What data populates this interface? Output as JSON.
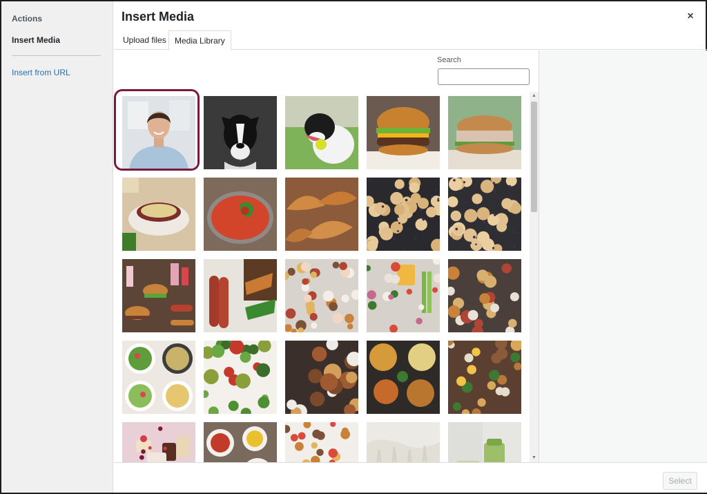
{
  "sidebar": {
    "heading": "Actions",
    "current": "Insert Media",
    "link": "Insert from URL"
  },
  "header": {
    "title": "Insert Media",
    "close_icon": "×"
  },
  "tabs": [
    {
      "label": "Upload files",
      "active": false
    },
    {
      "label": "Media Library",
      "active": true
    }
  ],
  "search": {
    "label": "Search",
    "value": ""
  },
  "media": [
    {
      "subject": "woman-portrait",
      "selected": true
    },
    {
      "subject": "dog-bw"
    },
    {
      "subject": "dog-ball"
    },
    {
      "subject": "burger"
    },
    {
      "subject": "tuna-sandwich"
    },
    {
      "subject": "soup-bowl"
    },
    {
      "subject": "tomato-soup"
    },
    {
      "subject": "croissants"
    },
    {
      "subject": "scones-tray"
    },
    {
      "subject": "scones-tray-2"
    },
    {
      "subject": "diner-spread"
    },
    {
      "subject": "hot-dogs"
    },
    {
      "subject": "food-flatlay"
    },
    {
      "subject": "ingredients-flatlay"
    },
    {
      "subject": "appetizer-table"
    },
    {
      "subject": "salad-collage"
    },
    {
      "subject": "salad-plates"
    },
    {
      "subject": "dinner-table"
    },
    {
      "subject": "soup-bowls"
    },
    {
      "subject": "spice-bowls"
    },
    {
      "subject": "desserts"
    },
    {
      "subject": "tapas"
    },
    {
      "subject": "canapes"
    },
    {
      "subject": "white-fabric"
    },
    {
      "subject": "green-drink"
    }
  ],
  "footer": {
    "select_label": "Select"
  }
}
